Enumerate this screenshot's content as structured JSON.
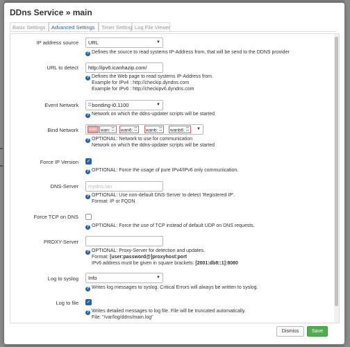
{
  "modal": {
    "title": "DDns Service » main"
  },
  "tabs": [
    {
      "label": "Basic Settings",
      "active": false
    },
    {
      "label": "Advanced Settings",
      "active": true
    },
    {
      "label": "Timer Settings",
      "active": false
    },
    {
      "label": "Log File Viewer",
      "active": false
    }
  ],
  "fields": {
    "ip_source": {
      "label": "IP address source",
      "value": "URL",
      "help": "Defines the source to read systems IP-Address from, that will be send to the DDNS provider"
    },
    "url_detect": {
      "label": "URL to detect",
      "value": "http://ipv6.icanhazip.com/",
      "help1": "Defines the Web page to read systems IP-Address from.",
      "help2": "Example for IPv4 : http://checkip.dyndns.com",
      "help3": "Example for IPv6 : http://checkipv6.dyndns.com"
    },
    "event_network": {
      "label": "Event Network",
      "value": "bonding-i0.1100",
      "help": "Network on which the ddns-updater scripts will be started"
    },
    "bind_network": {
      "label": "Bind Network",
      "chips": [
        "wan",
        "wan:",
        "wan6:",
        "wanb:",
        "wanb6:"
      ],
      "help1": "OPTIONAL: Network to use for communication",
      "help2": "Network on which the ddns-updater scripts will be started"
    },
    "force_ip": {
      "label": "Force IP Version",
      "checked": true,
      "help": "OPTIONAL: Force the usage of pure IPv4/IPv6 only communication."
    },
    "dns_server": {
      "label": "DNS-Server",
      "placeholder": "mydns.lan",
      "help1": "OPTIONAL: Use non-default DNS-Server to detect 'Registered IP'.",
      "help2": "Format: IP or FQDN"
    },
    "force_tcp": {
      "label": "Force TCP on DNS",
      "checked": false,
      "help": "OPTIONAL: Force the use of TCP instead of default UDP on DNS requests."
    },
    "proxy": {
      "label": "PROXY-Server",
      "value": "",
      "help1": "OPTIONAL: Proxy-Server for detection and updates.",
      "help2_prefix": "Format: ",
      "help2_bold": "[user:password@]proxyhost:port",
      "help3_prefix": "IPv6 address must be given in square brackets: ",
      "help3_bold": "[2001:db8::1]:8080"
    },
    "log_syslog": {
      "label": "Log to syslog",
      "value": "Info",
      "help": "Writes log messages to syslog. Critical Errors will always be written to syslog."
    },
    "log_file": {
      "label": "Log to file",
      "checked": true,
      "help1": "Writes detailed messages to log file. File will be truncated automatically.",
      "help2": "File: \"/var/log/ddns/main.log\""
    }
  },
  "footer": {
    "dismiss": "Dismiss",
    "save": "Save"
  },
  "icons": {
    "help": "question-circle-icon",
    "caret": "chevron-down-icon",
    "check": "checkmark-icon",
    "network": "network-icon"
  },
  "colors": {
    "accent": "#1d63b8",
    "save": "#4cae4c",
    "chip_border": "#e06060"
  }
}
